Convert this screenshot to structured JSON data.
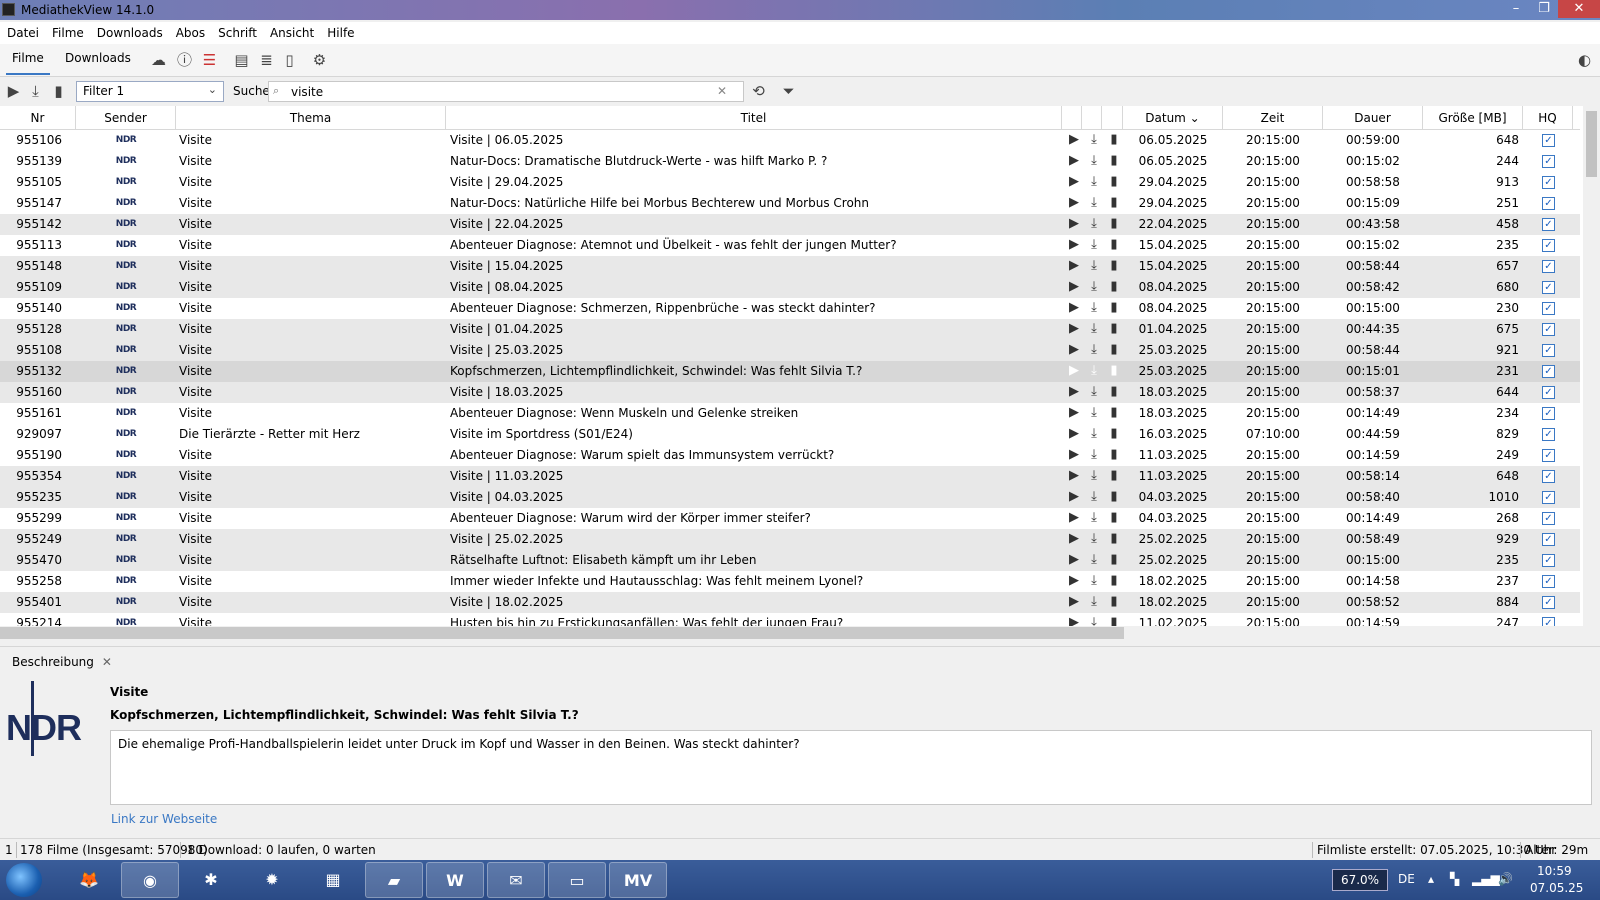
{
  "window": {
    "title": "MediathekView 14.1.0"
  },
  "menu": [
    "Datei",
    "Filme",
    "Downloads",
    "Abos",
    "Schrift",
    "Ansicht",
    "Hilfe"
  ],
  "tabs": {
    "filme": "Filme",
    "downloads": "Downloads"
  },
  "filter": {
    "selected": "Filter 1"
  },
  "search": {
    "label": "Suche:",
    "value": "visite"
  },
  "columns": [
    "Nr",
    "Sender",
    "Thema",
    "Titel",
    "Datum",
    "Zeit",
    "Dauer",
    "Größe [MB]",
    "HQ"
  ],
  "sender_logo": "NDR",
  "rows": [
    [
      "955106",
      "Visite",
      "Visite | 06.05.2025",
      "06.05.2025",
      "20:15:00",
      "00:59:00",
      "648"
    ],
    [
      "955139",
      "Visite",
      "Natur-Docs: Dramatische Blutdruck-Werte - was hilft Marko P. ?",
      "06.05.2025",
      "20:15:00",
      "00:15:02",
      "244"
    ],
    [
      "955105",
      "Visite",
      "Visite | 29.04.2025",
      "29.04.2025",
      "20:15:00",
      "00:58:58",
      "913"
    ],
    [
      "955147",
      "Visite",
      "Natur-Docs: Natürliche Hilfe bei Morbus Bechterew und Morbus Crohn",
      "29.04.2025",
      "20:15:00",
      "00:15:09",
      "251"
    ],
    [
      "955142",
      "Visite",
      "Visite | 22.04.2025",
      "22.04.2025",
      "20:15:00",
      "00:43:58",
      "458"
    ],
    [
      "955113",
      "Visite",
      "Abenteuer Diagnose: Atemnot und Übelkeit - was fehlt der jungen Mutter?",
      "15.04.2025",
      "20:15:00",
      "00:15:02",
      "235"
    ],
    [
      "955148",
      "Visite",
      "Visite | 15.04.2025",
      "15.04.2025",
      "20:15:00",
      "00:58:44",
      "657"
    ],
    [
      "955109",
      "Visite",
      "Visite | 08.04.2025",
      "08.04.2025",
      "20:15:00",
      "00:58:42",
      "680"
    ],
    [
      "955140",
      "Visite",
      "Abenteuer Diagnose: Schmerzen, Rippenbrüche - was steckt dahinter?",
      "08.04.2025",
      "20:15:00",
      "00:15:00",
      "230"
    ],
    [
      "955128",
      "Visite",
      "Visite | 01.04.2025",
      "01.04.2025",
      "20:15:00",
      "00:44:35",
      "675"
    ],
    [
      "955108",
      "Visite",
      "Visite | 25.03.2025",
      "25.03.2025",
      "20:15:00",
      "00:58:44",
      "921"
    ],
    [
      "955132",
      "Visite",
      "Kopfschmerzen, Lichtempflindlichkeit, Schwindel: Was fehlt Silvia T.?",
      "25.03.2025",
      "20:15:00",
      "00:15:01",
      "231"
    ],
    [
      "955160",
      "Visite",
      "Visite | 18.03.2025",
      "18.03.2025",
      "20:15:00",
      "00:58:37",
      "644"
    ],
    [
      "955161",
      "Visite",
      "Abenteuer Diagnose: Wenn Muskeln und Gelenke streiken",
      "18.03.2025",
      "20:15:00",
      "00:14:49",
      "234"
    ],
    [
      "929097",
      "Die Tierärzte - Retter mit Herz",
      "Visite im Sportdress (S01/E24)",
      "16.03.2025",
      "07:10:00",
      "00:44:59",
      "829"
    ],
    [
      "955190",
      "Visite",
      "Abenteuer Diagnose: Warum spielt das Immunsystem verrückt?",
      "11.03.2025",
      "20:15:00",
      "00:14:59",
      "249"
    ],
    [
      "955354",
      "Visite",
      "Visite | 11.03.2025",
      "11.03.2025",
      "20:15:00",
      "00:58:14",
      "648"
    ],
    [
      "955235",
      "Visite",
      "Visite | 04.03.2025",
      "04.03.2025",
      "20:15:00",
      "00:58:40",
      "1010"
    ],
    [
      "955299",
      "Visite",
      "Abenteuer Diagnose: Warum wird der Körper immer steifer?",
      "04.03.2025",
      "20:15:00",
      "00:14:49",
      "268"
    ],
    [
      "955249",
      "Visite",
      "Visite | 25.02.2025",
      "25.02.2025",
      "20:15:00",
      "00:58:49",
      "929"
    ],
    [
      "955470",
      "Visite",
      "Rätselhafte Luftnot: Elisabeth kämpft um ihr Leben",
      "25.02.2025",
      "20:15:00",
      "00:15:00",
      "235"
    ],
    [
      "955258",
      "Visite",
      "Immer wieder Infekte und Hautausschlag: Was fehlt meinem Lyonel?",
      "18.02.2025",
      "20:15:00",
      "00:14:58",
      "237"
    ],
    [
      "955401",
      "Visite",
      "Visite | 18.02.2025",
      "18.02.2025",
      "20:15:00",
      "00:58:52",
      "884"
    ],
    [
      "955214",
      "Visite",
      "Husten bis hin zu Erstickungsanfällen: Was fehlt der jungen Frau?",
      "11.02.2025",
      "20:15:00",
      "00:14:59",
      "247"
    ]
  ],
  "description": {
    "tab_label": "Beschreibung",
    "thema": "Visite",
    "titel": "Kopfschmerzen, Lichtempflindlichkeit, Schwindel: Was fehlt Silvia T.?",
    "text": "Die ehemalige Profi-Handballspielerin leidet unter Druck im Kopf und Wasser in den Beinen. Was steckt dahinter?",
    "link": "Link zur Webseite"
  },
  "status": {
    "selected": "1",
    "films": "178 Filme (Insgesamt: 570980)",
    "downloads": "1 Download: 0 laufen, 0 warten",
    "list_created": "Filmliste erstellt: 07.05.2025, 10:30 Uhr",
    "age": "Alter: 29m"
  },
  "taskbar": {
    "cpu": "67.0%",
    "lang": "DE",
    "time": "10:59",
    "date": "07.05.25"
  }
}
